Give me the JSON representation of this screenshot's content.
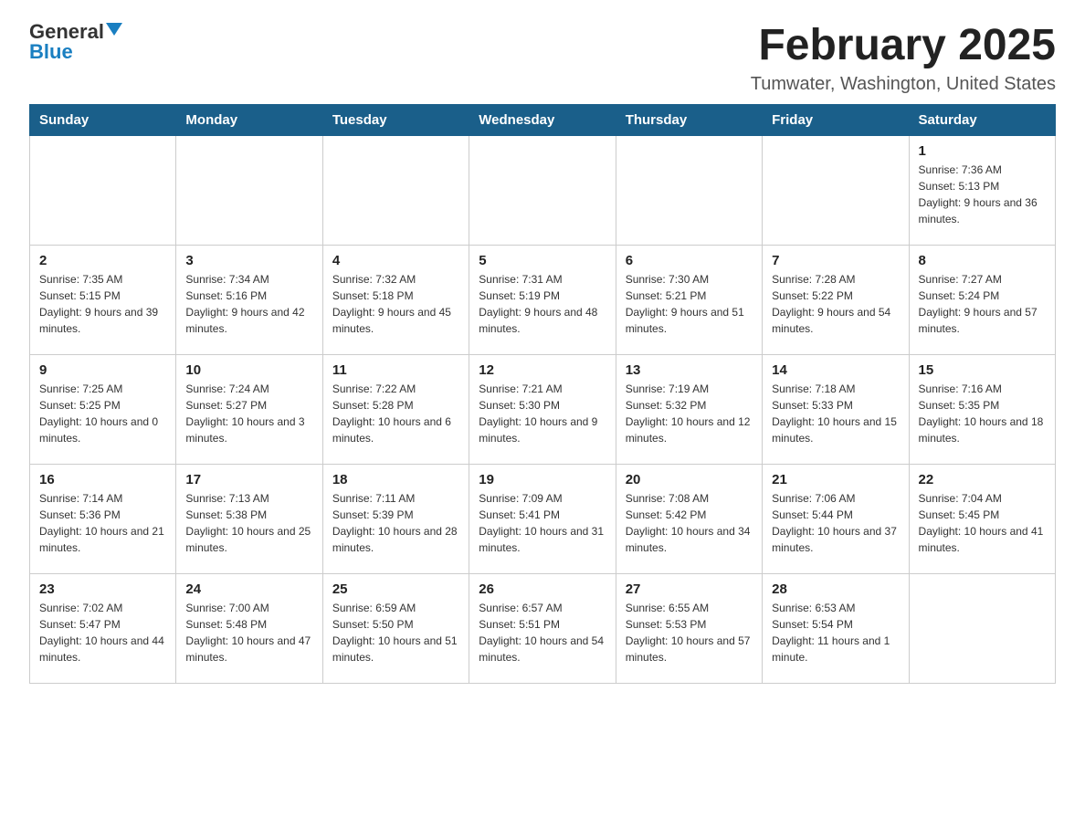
{
  "logo": {
    "general": "General",
    "blue": "Blue"
  },
  "title": "February 2025",
  "subtitle": "Tumwater, Washington, United States",
  "days_of_week": [
    "Sunday",
    "Monday",
    "Tuesday",
    "Wednesday",
    "Thursday",
    "Friday",
    "Saturday"
  ],
  "weeks": [
    [
      {
        "day": "",
        "info": ""
      },
      {
        "day": "",
        "info": ""
      },
      {
        "day": "",
        "info": ""
      },
      {
        "day": "",
        "info": ""
      },
      {
        "day": "",
        "info": ""
      },
      {
        "day": "",
        "info": ""
      },
      {
        "day": "1",
        "info": "Sunrise: 7:36 AM\nSunset: 5:13 PM\nDaylight: 9 hours and 36 minutes."
      }
    ],
    [
      {
        "day": "2",
        "info": "Sunrise: 7:35 AM\nSunset: 5:15 PM\nDaylight: 9 hours and 39 minutes."
      },
      {
        "day": "3",
        "info": "Sunrise: 7:34 AM\nSunset: 5:16 PM\nDaylight: 9 hours and 42 minutes."
      },
      {
        "day": "4",
        "info": "Sunrise: 7:32 AM\nSunset: 5:18 PM\nDaylight: 9 hours and 45 minutes."
      },
      {
        "day": "5",
        "info": "Sunrise: 7:31 AM\nSunset: 5:19 PM\nDaylight: 9 hours and 48 minutes."
      },
      {
        "day": "6",
        "info": "Sunrise: 7:30 AM\nSunset: 5:21 PM\nDaylight: 9 hours and 51 minutes."
      },
      {
        "day": "7",
        "info": "Sunrise: 7:28 AM\nSunset: 5:22 PM\nDaylight: 9 hours and 54 minutes."
      },
      {
        "day": "8",
        "info": "Sunrise: 7:27 AM\nSunset: 5:24 PM\nDaylight: 9 hours and 57 minutes."
      }
    ],
    [
      {
        "day": "9",
        "info": "Sunrise: 7:25 AM\nSunset: 5:25 PM\nDaylight: 10 hours and 0 minutes."
      },
      {
        "day": "10",
        "info": "Sunrise: 7:24 AM\nSunset: 5:27 PM\nDaylight: 10 hours and 3 minutes."
      },
      {
        "day": "11",
        "info": "Sunrise: 7:22 AM\nSunset: 5:28 PM\nDaylight: 10 hours and 6 minutes."
      },
      {
        "day": "12",
        "info": "Sunrise: 7:21 AM\nSunset: 5:30 PM\nDaylight: 10 hours and 9 minutes."
      },
      {
        "day": "13",
        "info": "Sunrise: 7:19 AM\nSunset: 5:32 PM\nDaylight: 10 hours and 12 minutes."
      },
      {
        "day": "14",
        "info": "Sunrise: 7:18 AM\nSunset: 5:33 PM\nDaylight: 10 hours and 15 minutes."
      },
      {
        "day": "15",
        "info": "Sunrise: 7:16 AM\nSunset: 5:35 PM\nDaylight: 10 hours and 18 minutes."
      }
    ],
    [
      {
        "day": "16",
        "info": "Sunrise: 7:14 AM\nSunset: 5:36 PM\nDaylight: 10 hours and 21 minutes."
      },
      {
        "day": "17",
        "info": "Sunrise: 7:13 AM\nSunset: 5:38 PM\nDaylight: 10 hours and 25 minutes."
      },
      {
        "day": "18",
        "info": "Sunrise: 7:11 AM\nSunset: 5:39 PM\nDaylight: 10 hours and 28 minutes."
      },
      {
        "day": "19",
        "info": "Sunrise: 7:09 AM\nSunset: 5:41 PM\nDaylight: 10 hours and 31 minutes."
      },
      {
        "day": "20",
        "info": "Sunrise: 7:08 AM\nSunset: 5:42 PM\nDaylight: 10 hours and 34 minutes."
      },
      {
        "day": "21",
        "info": "Sunrise: 7:06 AM\nSunset: 5:44 PM\nDaylight: 10 hours and 37 minutes."
      },
      {
        "day": "22",
        "info": "Sunrise: 7:04 AM\nSunset: 5:45 PM\nDaylight: 10 hours and 41 minutes."
      }
    ],
    [
      {
        "day": "23",
        "info": "Sunrise: 7:02 AM\nSunset: 5:47 PM\nDaylight: 10 hours and 44 minutes."
      },
      {
        "day": "24",
        "info": "Sunrise: 7:00 AM\nSunset: 5:48 PM\nDaylight: 10 hours and 47 minutes."
      },
      {
        "day": "25",
        "info": "Sunrise: 6:59 AM\nSunset: 5:50 PM\nDaylight: 10 hours and 51 minutes."
      },
      {
        "day": "26",
        "info": "Sunrise: 6:57 AM\nSunset: 5:51 PM\nDaylight: 10 hours and 54 minutes."
      },
      {
        "day": "27",
        "info": "Sunrise: 6:55 AM\nSunset: 5:53 PM\nDaylight: 10 hours and 57 minutes."
      },
      {
        "day": "28",
        "info": "Sunrise: 6:53 AM\nSunset: 5:54 PM\nDaylight: 11 hours and 1 minute."
      },
      {
        "day": "",
        "info": ""
      }
    ]
  ]
}
